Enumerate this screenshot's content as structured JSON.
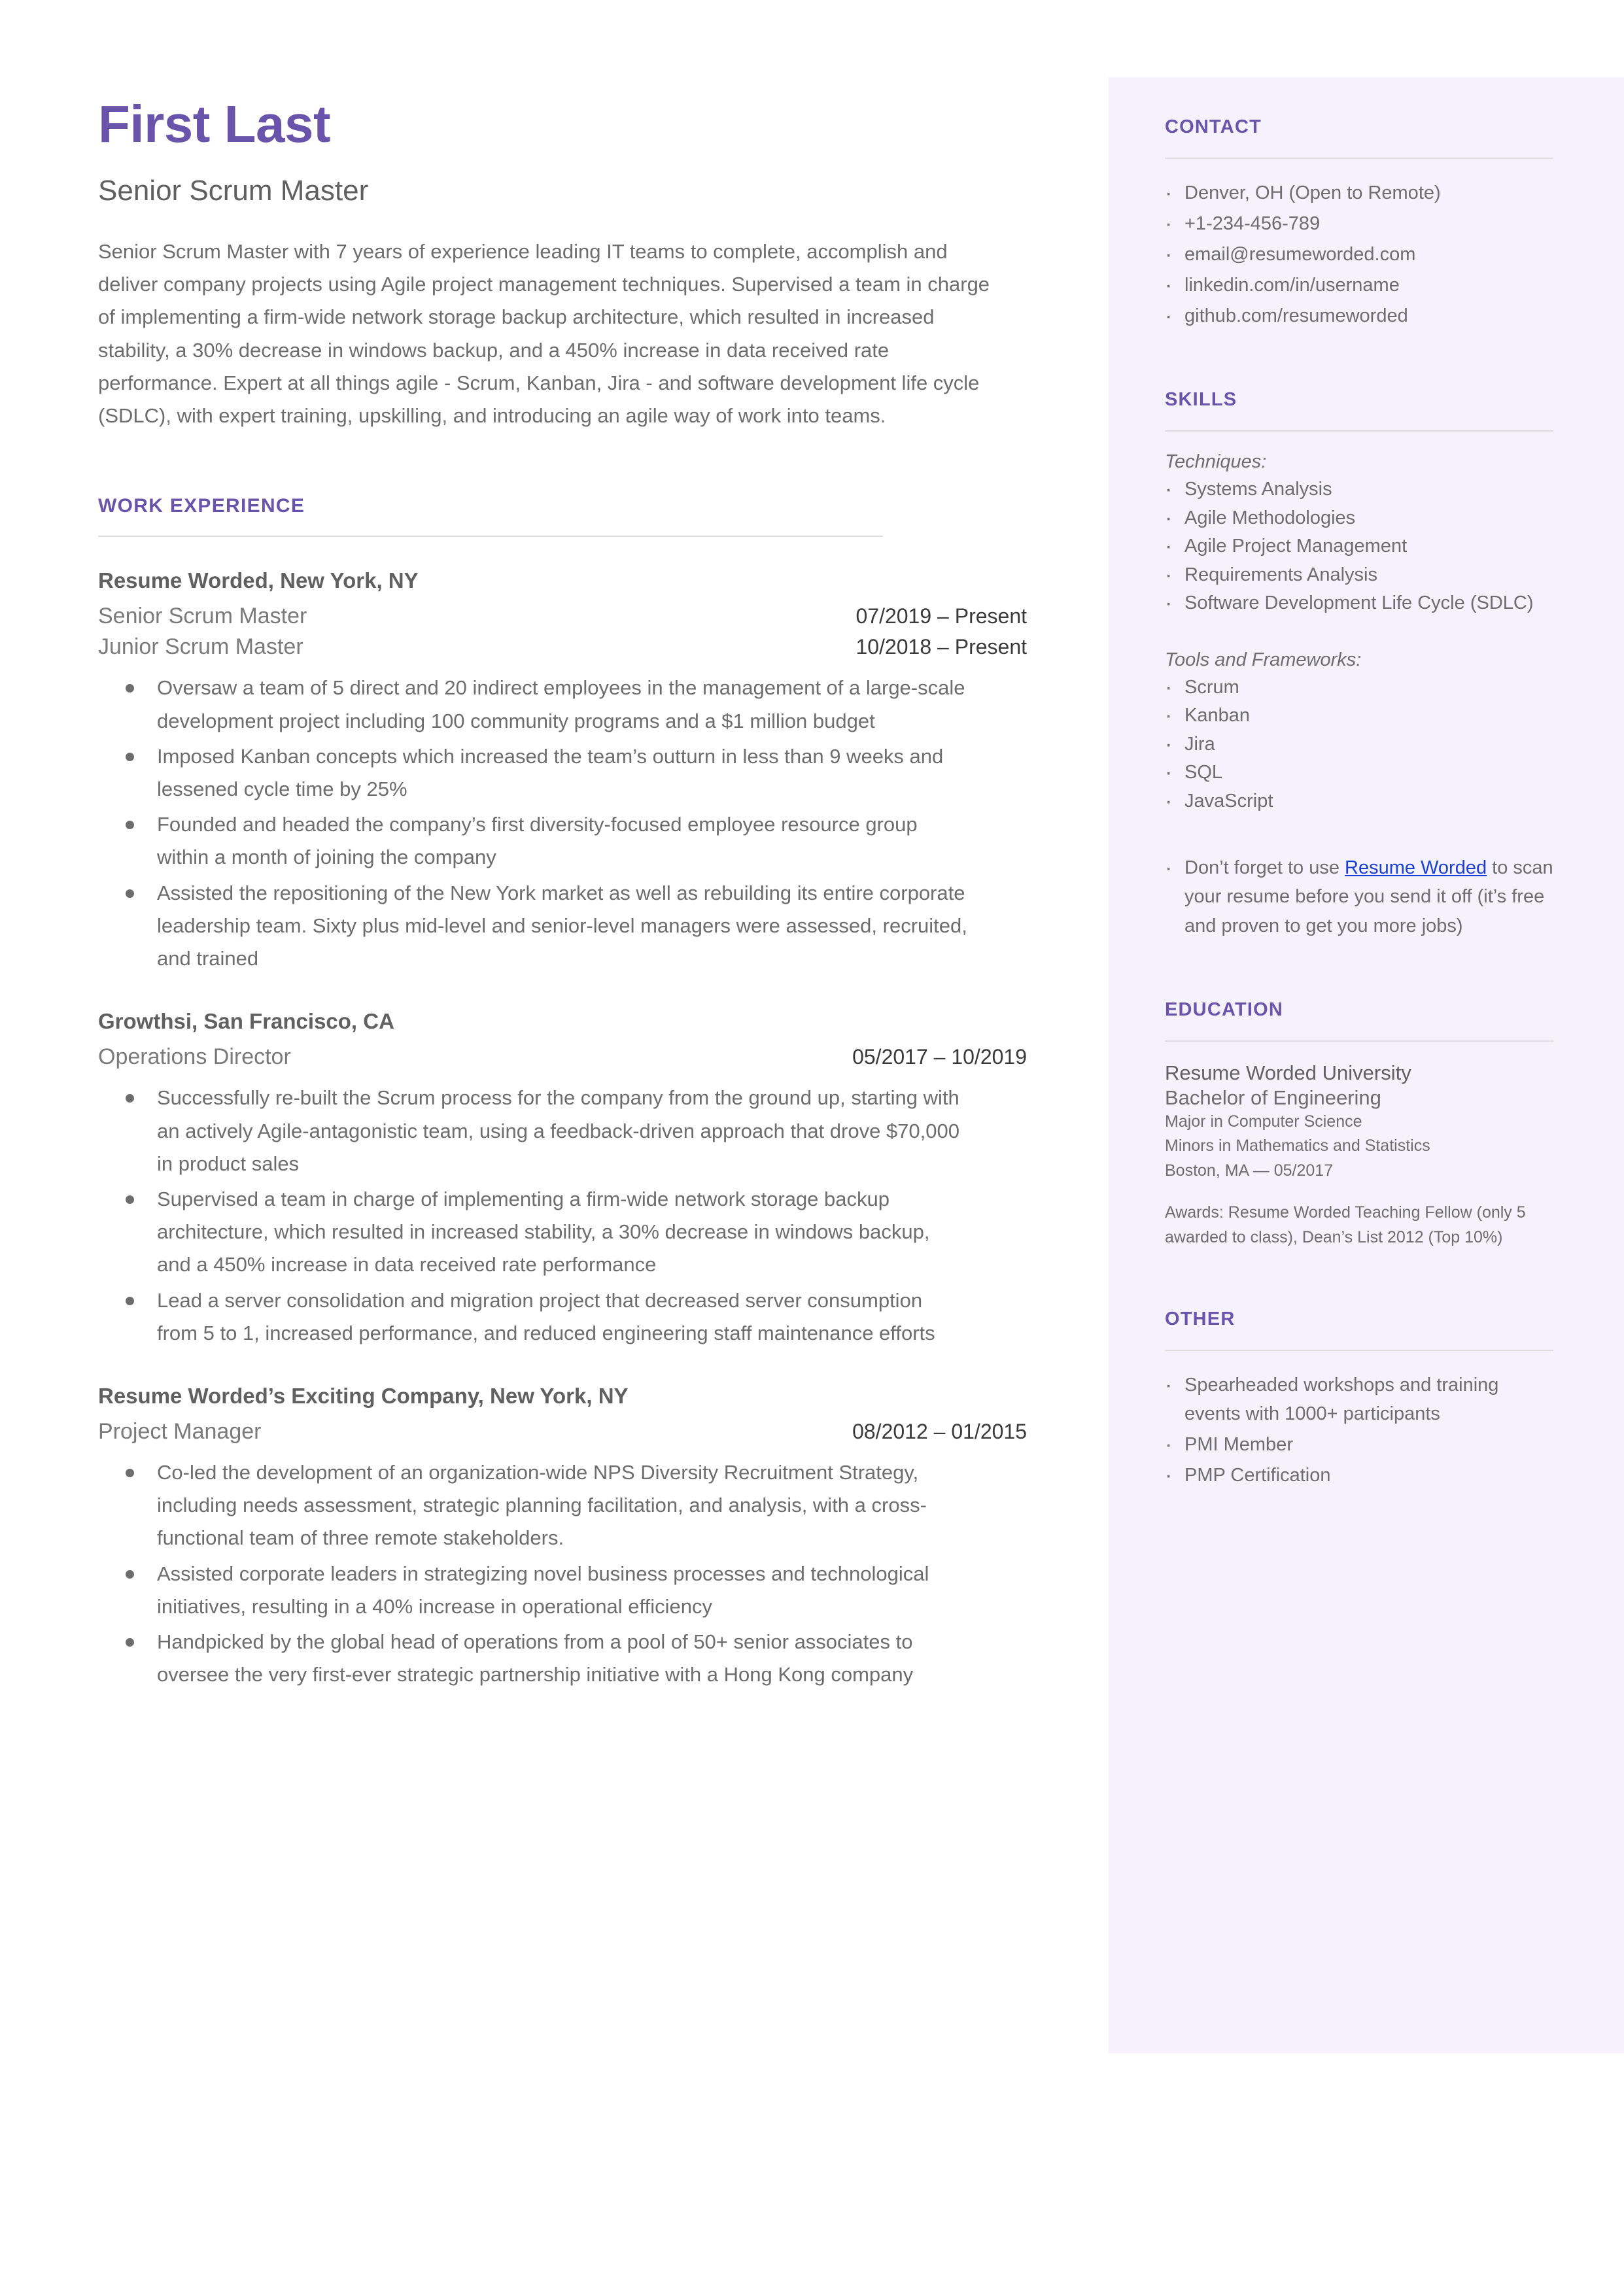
{
  "theme": {
    "accent": "#6a54ab",
    "sidebar_bg": "#f5f2fd",
    "body_text": "#6d6d6d",
    "link": "#1a3fd4"
  },
  "header": {
    "name": "First Last",
    "title": "Senior Scrum Master",
    "summary": "Senior Scrum Master with 7 years of experience leading IT teams to complete, accomplish and deliver company projects using Agile project management techniques. Supervised a team in charge of implementing a firm-wide network storage backup architecture, which resulted in increased stability, a 30% decrease in windows backup, and a 450% increase in data received rate performance. Expert at all things agile - Scrum, Kanban, Jira - and software development life cycle (SDLC), with expert training, upskilling, and introducing an agile way of work into teams."
  },
  "work_experience": {
    "heading": "WORK EXPERIENCE",
    "jobs": [
      {
        "company": "Resume Worded, New York, NY",
        "roles": [
          {
            "title": "Senior Scrum Master",
            "dates": "07/2019 – Present"
          },
          {
            "title": "Junior Scrum Master",
            "dates": "10/2018 – Present"
          }
        ],
        "bullets": [
          "Oversaw a team of 5 direct and 20 indirect employees in the management of a large-scale development project including 100 community programs and a $1 million budget",
          "Imposed Kanban concepts which increased the team’s outturn in less than 9 weeks and lessened cycle time by 25%",
          "Founded and headed the company’s first diversity-focused employee resource group within a month of joining the company",
          "Assisted the repositioning of the New York market as well as rebuilding its entire corporate leadership team. Sixty plus mid-level and senior-level managers were assessed, recruited, and trained"
        ]
      },
      {
        "company": "Growthsi, San Francisco, CA",
        "roles": [
          {
            "title": "Operations Director",
            "dates": "05/2017 – 10/2019"
          }
        ],
        "bullets": [
          "Successfully re-built the Scrum process for the company from the ground up, starting with an actively Agile-antagonistic team, using a feedback-driven approach that drove $70,000 in product sales",
          "Supervised a team in charge of implementing a firm-wide network storage backup architecture, which resulted in increased stability, a 30% decrease in windows backup, and a 450% increase in data received rate performance",
          "Lead a server consolidation and migration project that decreased server consumption from 5 to 1, increased performance, and reduced engineering staff maintenance efforts"
        ]
      },
      {
        "company": "Resume Worded’s Exciting Company, New York, NY",
        "roles": [
          {
            "title": "Project Manager",
            "dates": "08/2012 – 01/2015"
          }
        ],
        "bullets": [
          "Co-led the development of an organization-wide NPS Diversity Recruitment Strategy, including needs assessment, strategic planning facilitation, and analysis, with a cross-functional team of three remote stakeholders.",
          "Assisted corporate leaders in strategizing novel business processes and technological initiatives, resulting in a 40% increase in operational efficiency",
          "Handpicked by the global head of operations from a pool of 50+ senior associates to oversee the very first-ever strategic partnership initiative with a Hong Kong company"
        ]
      }
    ]
  },
  "sidebar": {
    "contact": {
      "heading": "CONTACT",
      "items": [
        "Denver, OH (Open to Remote)",
        "+1-234-456-789",
        "email@resumeworded.com",
        "linkedin.com/in/username",
        "github.com/resumeworded"
      ]
    },
    "skills": {
      "heading": "SKILLS",
      "groups": [
        {
          "label": "Techniques:",
          "items": [
            "Systems Analysis",
            "Agile Methodologies",
            "Agile Project Management",
            "Requirements Analysis",
            "Software Development Life Cycle (SDLC)"
          ]
        },
        {
          "label": "Tools and Frameworks:",
          "items": [
            "Scrum",
            "Kanban",
            "Jira",
            "SQL",
            "JavaScript"
          ]
        }
      ],
      "promo": {
        "before": "Don’t forget to use ",
        "link": "Resume Worded",
        "after": " to scan your resume before you send it off (it’s free and proven to get you more jobs)"
      }
    },
    "education": {
      "heading": "EDUCATION",
      "school": "Resume Worded University",
      "degree": "Bachelor of Engineering",
      "major": "Major in Computer Science",
      "minors": "Minors in Mathematics and Statistics",
      "location_date": "Boston, MA — 05/2017",
      "awards": "Awards: Resume Worded Teaching Fellow (only 5 awarded to class), Dean’s List 2012 (Top 10%)"
    },
    "other": {
      "heading": "OTHER",
      "items": [
        "Spearheaded workshops and training events with 1000+ participants",
        "PMI Member",
        "PMP Certification"
      ]
    }
  }
}
